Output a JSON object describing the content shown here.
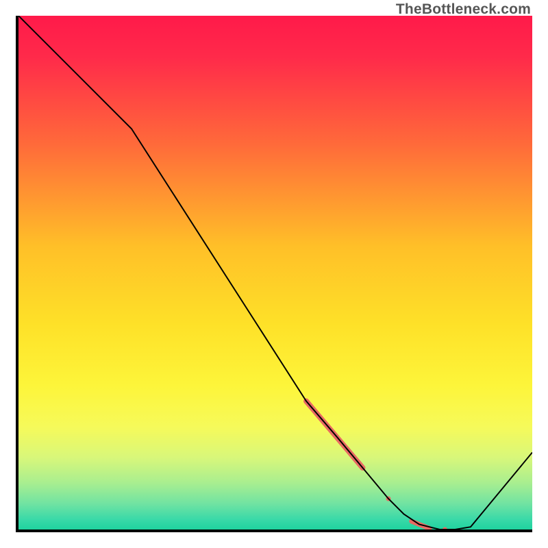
{
  "watermark": "TheBottleneck.com",
  "chart_data": {
    "type": "line",
    "title": "",
    "xlabel": "",
    "ylabel": "",
    "xlim": [
      0,
      100
    ],
    "ylim": [
      0,
      100
    ],
    "grid": false,
    "series": [
      {
        "name": "bottleneck-curve",
        "x": [
          0,
          22,
          56,
          62,
          67,
          72,
          75,
          78,
          82,
          85,
          88,
          100
        ],
        "values": [
          100,
          78,
          25,
          18,
          12,
          6,
          3,
          1,
          0,
          0,
          0.5,
          15
        ],
        "color": "#000000",
        "width": 2
      }
    ],
    "highlights": [
      {
        "name": "highlight-segment-main",
        "x0": 56,
        "y0": 25,
        "x1": 67,
        "y1": 12,
        "color": "#e86a62",
        "width": 8
      },
      {
        "name": "highlight-dot-1",
        "x": 72,
        "y": 6,
        "r": 3.5,
        "color": "#e86a62"
      },
      {
        "name": "highlight-segment-2",
        "x0": 76.5,
        "y0": 1.6,
        "x1": 80,
        "y1": 0.2,
        "color": "#e86a62",
        "width": 7
      },
      {
        "name": "highlight-dot-2",
        "x": 83,
        "y": 0,
        "r": 3.5,
        "color": "#e86a62"
      }
    ],
    "background_gradient": {
      "type": "vertical",
      "stops": [
        {
          "offset": 0,
          "color": "#ff1a4a"
        },
        {
          "offset": 0.08,
          "color": "#ff2a4a"
        },
        {
          "offset": 0.25,
          "color": "#ff6a3a"
        },
        {
          "offset": 0.45,
          "color": "#ffc028"
        },
        {
          "offset": 0.6,
          "color": "#fee128"
        },
        {
          "offset": 0.72,
          "color": "#fdf53a"
        },
        {
          "offset": 0.8,
          "color": "#f6fa5a"
        },
        {
          "offset": 0.86,
          "color": "#d8f77a"
        },
        {
          "offset": 0.91,
          "color": "#a8ee90"
        },
        {
          "offset": 0.95,
          "color": "#70e3a2"
        },
        {
          "offset": 0.98,
          "color": "#3ad9a8"
        },
        {
          "offset": 1.0,
          "color": "#1fd39f"
        }
      ]
    }
  }
}
